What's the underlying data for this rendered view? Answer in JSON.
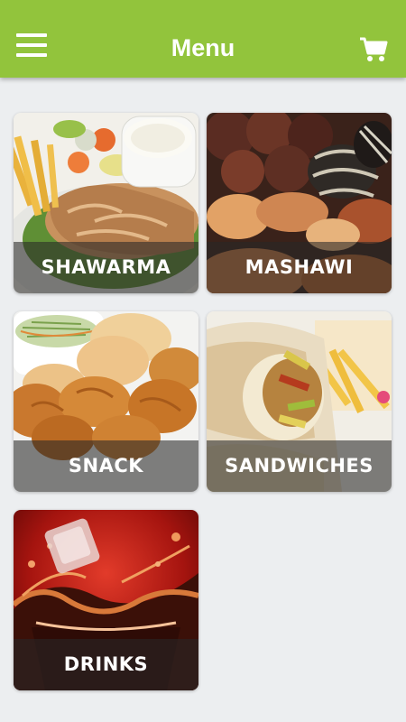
{
  "header": {
    "title": "Menu",
    "menu_icon": "hamburger-menu-icon",
    "cart_icon": "shopping-cart-icon"
  },
  "categories": [
    {
      "label": "SHAWARMA",
      "image": "shawarma-plate-photo"
    },
    {
      "label": "MASHAWI",
      "image": "grilled-meat-photo"
    },
    {
      "label": "SNACK",
      "image": "fried-chicken-photo"
    },
    {
      "label": "SANDWICHES",
      "image": "wrap-sandwich-photo"
    },
    {
      "label": "DRINKS",
      "image": "cola-splash-photo"
    }
  ],
  "colors": {
    "appbar": "#92c43c",
    "background": "#eceef0"
  }
}
